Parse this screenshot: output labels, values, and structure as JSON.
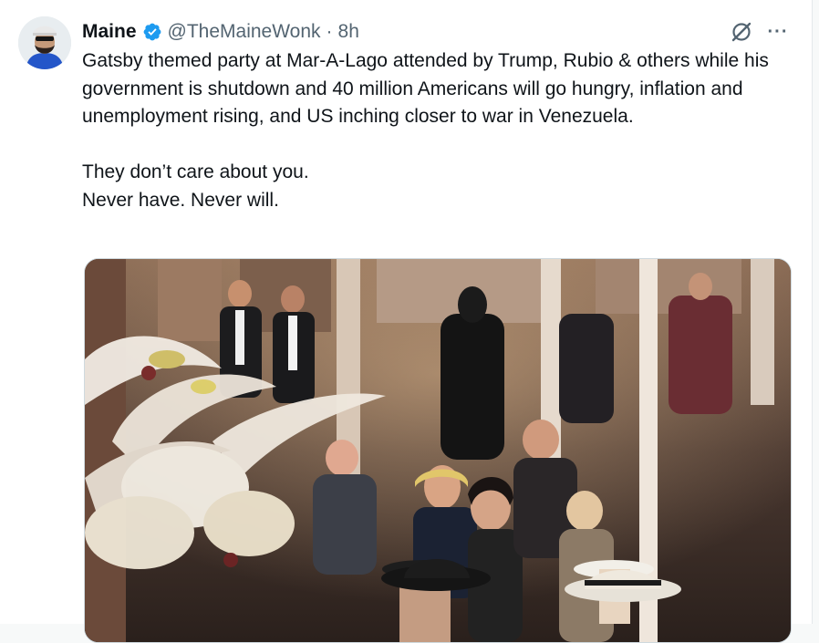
{
  "post": {
    "author_name": "Maine",
    "handle": "@TheMaineWonk",
    "separator": "·",
    "time": "8h",
    "more_label": "···",
    "paragraphs": [
      "Gatsby themed party at Mar-A-Lago attended by Trump, Rubio & others while his government is shutdown and 40 million Americans will go hungry, inflation and unemployment rising, and US inching closer to war in Venezuela.",
      "They don’t care about you.",
      "Never have. Never will."
    ]
  },
  "icons": {
    "verified": "verified-badge-icon",
    "grok": "grok-icon",
    "more": "more-options-icon"
  },
  "colors": {
    "verified_blue": "#1d9bf0",
    "secondary_text": "#536471",
    "primary_text": "#0f1419"
  }
}
